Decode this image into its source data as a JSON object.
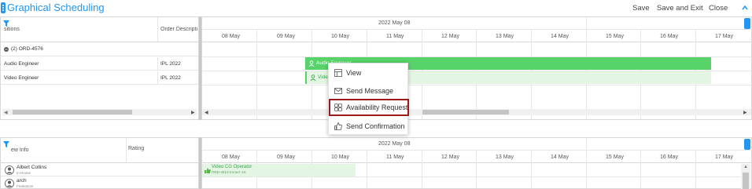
{
  "header": {
    "title": "Graphical Scheduling",
    "save": "Save",
    "save_exit": "Save and Exit",
    "close": "Close"
  },
  "top": {
    "col_positions": "sitions",
    "col_order": "Order Descripti",
    "date_title": "2022 May 08",
    "days": [
      "08 May",
      "09 May",
      "10 May",
      "11 May",
      "12 May",
      "13 May",
      "14 May",
      "15 May",
      "16 May",
      "17 May"
    ],
    "group": "(2) ORD-4576",
    "rows": [
      {
        "position": "Audio Engineer",
        "order": "IPL 2022",
        "bar": "Audio Engineer"
      },
      {
        "position": "Video Engineer",
        "order": "IPL 2022",
        "bar": "Video Engineer"
      }
    ]
  },
  "menu": {
    "items": [
      "View",
      "Send Message",
      "Availability Request",
      "Send Confirmation"
    ]
  },
  "bottom": {
    "col_crew": "ew Info",
    "col_rating": "Rating",
    "date_title": "2022 May 08",
    "days": [
      "08 May",
      "09 May",
      "10 May",
      "11 May",
      "12 May",
      "13 May",
      "14 May",
      "15 May",
      "16 May",
      "17 May"
    ],
    "crew": [
      {
        "name": "Albert Collins",
        "sub": "In House"
      },
      {
        "name": "arch",
        "sub": "Freelancer"
      }
    ],
    "booking": {
      "title": "Video CG Operator",
      "sub": "ORD-4513-Ironed -15"
    }
  },
  "colors": {
    "accent": "#2196f3",
    "bar_green": "#57d36a",
    "bar_light": "#e3f6e3",
    "highlight": "#9b1b1b"
  }
}
